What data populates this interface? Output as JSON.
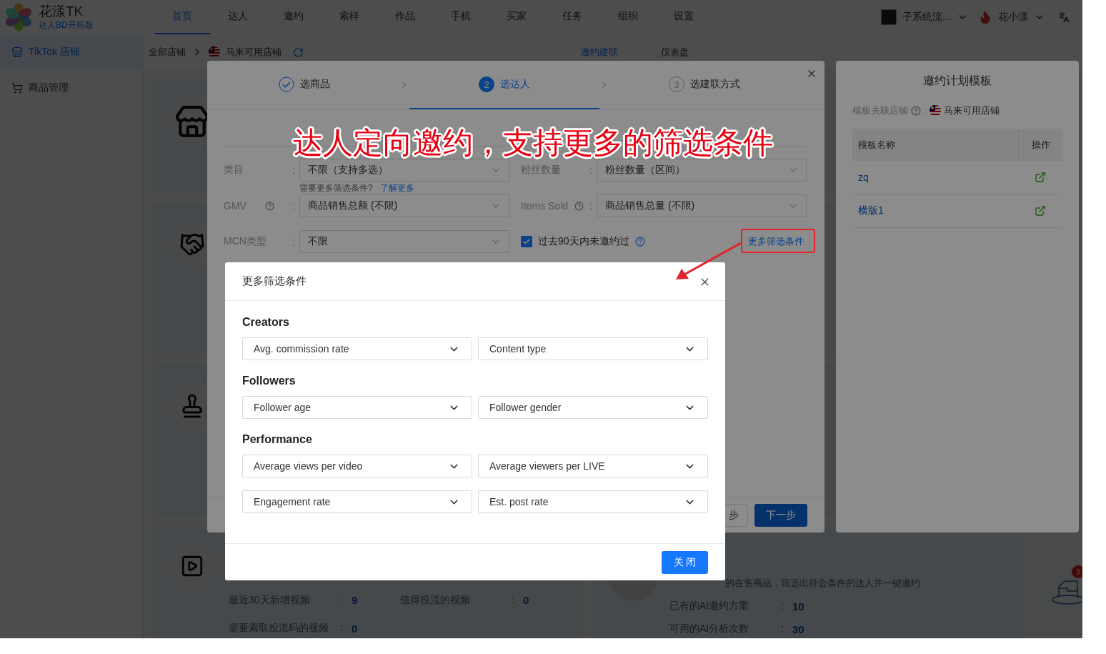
{
  "app": {
    "name": "花漾TK",
    "edition": "达人BD开拓版"
  },
  "nav": [
    {
      "label": "首页",
      "selected": true
    },
    {
      "label": "达人",
      "selected": false
    },
    {
      "label": "邀约",
      "selected": false
    },
    {
      "label": "索样",
      "selected": false
    },
    {
      "label": "作品",
      "selected": false
    },
    {
      "label": "手机",
      "selected": false
    },
    {
      "label": "买家",
      "selected": false
    },
    {
      "label": "任务",
      "selected": false
    },
    {
      "label": "组织",
      "selected": false
    },
    {
      "label": "设置",
      "selected": false
    }
  ],
  "user": {
    "account": "子系统流...",
    "name": "花小漾"
  },
  "sidebar": [
    {
      "label": "TikTok 店铺",
      "selected": true,
      "kind": "shop"
    },
    {
      "label": "商品管理",
      "selected": false,
      "kind": "cart"
    }
  ],
  "breadcrumb": {
    "root": "全部店铺",
    "shop": "马来可用店铺"
  },
  "page_tabs": [
    {
      "label": "邀约建联",
      "selected": true
    },
    {
      "label": "仪表盘",
      "selected": false
    }
  ],
  "video_stats": [
    {
      "label": "最近30天新增视频",
      "colon": ":",
      "value": "9"
    },
    {
      "label": "值得投流的视频",
      "colon": ":",
      "value": "0"
    },
    {
      "label": "需要索取投流码的视频",
      "colon": ":",
      "value": "0"
    }
  ],
  "ai_card": {
    "description": "的在售商品，筛选出符合条件的达人并一键邀约",
    "stats": [
      {
        "label": "已有的AI邀约方案",
        "colon": ":",
        "value": "10"
      },
      {
        "label": "可用的AI分析次数",
        "colon": ":",
        "value": "30"
      }
    ]
  },
  "notification_count": "3",
  "wizard": {
    "steps": [
      {
        "label": "选商品",
        "completed": true,
        "selected": false
      },
      {
        "number": "2",
        "label": "选达人",
        "completed": false,
        "selected": true
      },
      {
        "number": "3",
        "label": "选建联方式",
        "completed": false,
        "selected": false
      }
    ],
    "filters": [
      {
        "label": "类目",
        "colon": ":",
        "value": "不限（支持多选）",
        "help": false
      },
      {
        "label": "粉丝数量",
        "colon": ":",
        "value": "粉丝数量（区间）",
        "help": false
      },
      {
        "label": "GMV",
        "colon": ":",
        "value": "商品销售总额 (不限)",
        "help": true
      },
      {
        "label": "Items Sold",
        "colon": ":",
        "value": "商品销售总量 (不限)",
        "help": true
      },
      {
        "label": "MCN类型",
        "colon": ":",
        "value": "不限",
        "help": false
      }
    ],
    "hint": "需要更多筛选条件?",
    "hint_link": "了解更多",
    "uncontacted": {
      "label": "过去90天内未邀约过",
      "checked": true
    },
    "more_filters": "更多筛选条件",
    "buttons": [
      "步",
      "下一步"
    ]
  },
  "template_panel": {
    "title": "邀约计划模板",
    "store_label": "模板关联店铺",
    "colon": ":",
    "store": "马来可用店铺",
    "columns": [
      "模板名称",
      "操作"
    ],
    "rows": [
      "zq",
      "横版1"
    ]
  },
  "more_filters_dialog": {
    "title": "更多筛选条件",
    "sections": [
      {
        "title": "Creators",
        "fields": [
          "Avg. commission rate",
          "Content type"
        ]
      },
      {
        "title": "Followers",
        "fields": [
          "Follower age",
          "Follower gender"
        ]
      },
      {
        "title": "Performance",
        "fields": [
          "Average views per video",
          "Average viewers per LIVE",
          "Engagement rate",
          "Est. post rate"
        ]
      }
    ],
    "close_button": "关 闭"
  },
  "annotation": "达人定向邀约，支持更多的筛选条件"
}
